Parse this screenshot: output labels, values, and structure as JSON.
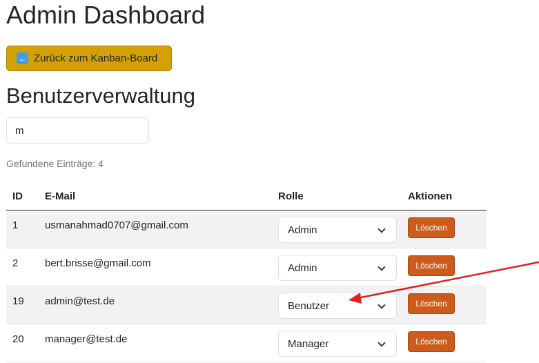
{
  "page": {
    "title": "Admin Dashboard",
    "back_button_label": "Zurück zum Kanban-Board",
    "back_icon_glyph": "←",
    "section_title": "Benutzerverwaltung"
  },
  "search": {
    "value": "m",
    "placeholder": ""
  },
  "results": {
    "count_text": "Gefundene Einträge: 4"
  },
  "table": {
    "headers": {
      "id": "ID",
      "email": "E-Mail",
      "role": "Rolle",
      "actions": "Aktionen"
    },
    "rows": [
      {
        "id": "1",
        "email": "usmanahmad0707@gmail.com",
        "role": "Admin",
        "action_label": "Löschen"
      },
      {
        "id": "2",
        "email": "bert.brisse@gmail.com",
        "role": "Admin",
        "action_label": "Löschen"
      },
      {
        "id": "19",
        "email": "admin@test.de",
        "role": "Benutzer",
        "action_label": "Löschen"
      },
      {
        "id": "20",
        "email": "manager@test.de",
        "role": "Manager",
        "action_label": "Löschen"
      }
    ]
  },
  "colors": {
    "back_button": "#d4a006",
    "delete_button": "#cc5b1c",
    "annotation_arrow": "#e02020",
    "striped_row": "#f2f2f2"
  },
  "icons": {
    "back": "arrow-left-icon",
    "select": "chevron-down-icon",
    "annotation": "red-annotation-arrow"
  }
}
